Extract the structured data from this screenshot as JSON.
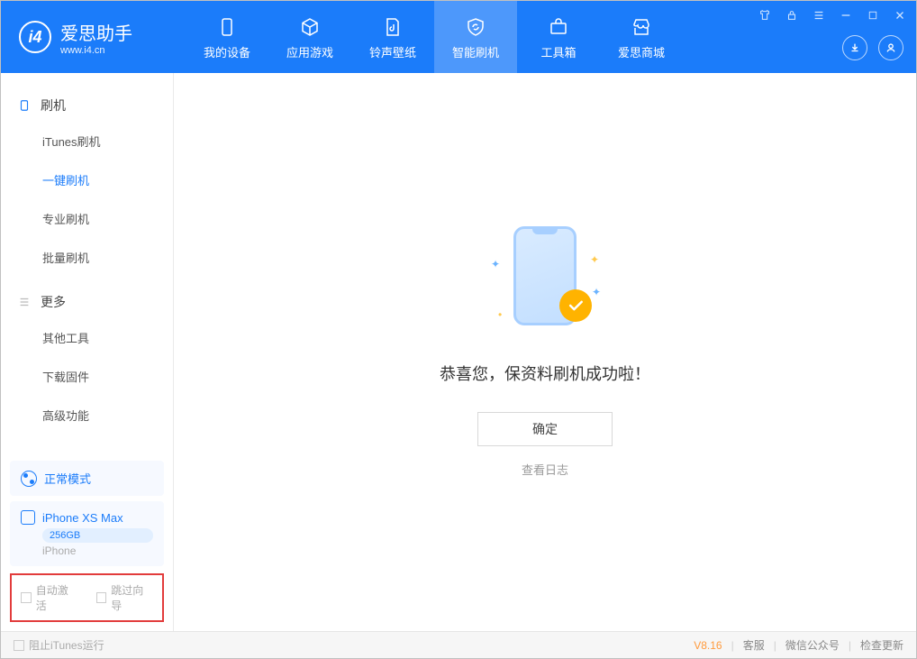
{
  "app": {
    "title": "爱思助手",
    "url": "www.i4.cn"
  },
  "nav": {
    "tabs": [
      {
        "label": "我的设备"
      },
      {
        "label": "应用游戏"
      },
      {
        "label": "铃声壁纸"
      },
      {
        "label": "智能刷机"
      },
      {
        "label": "工具箱"
      },
      {
        "label": "爱思商城"
      }
    ]
  },
  "sidebar": {
    "section1": {
      "title": "刷机",
      "items": [
        {
          "label": "iTunes刷机"
        },
        {
          "label": "一键刷机"
        },
        {
          "label": "专业刷机"
        },
        {
          "label": "批量刷机"
        }
      ]
    },
    "section2": {
      "title": "更多",
      "items": [
        {
          "label": "其他工具"
        },
        {
          "label": "下载固件"
        },
        {
          "label": "高级功能"
        }
      ]
    },
    "mode": "正常模式",
    "device": {
      "name": "iPhone XS Max",
      "storage": "256GB",
      "type": "iPhone"
    },
    "options": {
      "auto_activate": "自动激活",
      "skip_wizard": "跳过向导"
    }
  },
  "main": {
    "success_text": "恭喜您，保资料刷机成功啦！",
    "confirm": "确定",
    "view_log": "查看日志"
  },
  "footer": {
    "block_itunes": "阻止iTunes运行",
    "version": "V8.16",
    "links": {
      "service": "客服",
      "wechat": "微信公众号",
      "update": "检查更新"
    }
  }
}
